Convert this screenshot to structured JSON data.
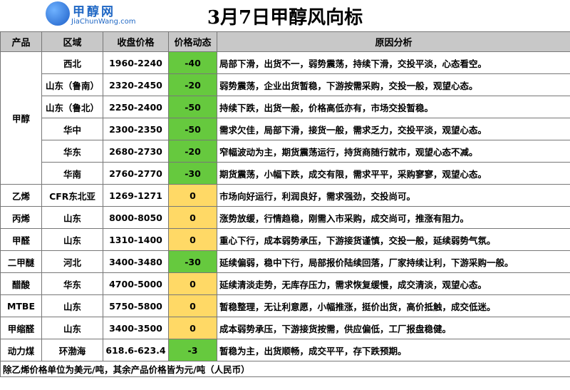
{
  "logo": {
    "cn": "甲醇网",
    "en": "JiaChunWang.com"
  },
  "title": "3月7日甲醇风向标",
  "headers": {
    "product": "产品",
    "region": "区域",
    "price": "收盘价格",
    "change": "价格动态",
    "reason": "原因分析"
  },
  "rows": [
    {
      "product": "甲醇",
      "region": "西北",
      "price": "1960-2240",
      "change": "-40",
      "reason": "局部下滑，出货不一，弱势震荡，持续下滑，交投平淡，心态看空。"
    },
    {
      "product": "",
      "region": "山东（鲁南）",
      "price": "2320-2450",
      "change": "-20",
      "reason": "弱势震荡，企业出货暂稳，下游按需采购，交投一般，观望心态。"
    },
    {
      "product": "",
      "region": "山东（鲁北）",
      "price": "2250-2400",
      "change": "-50",
      "reason": "持续下跌，出货一般，价格高低亦有，市场交投暂稳。"
    },
    {
      "product": "",
      "region": "华中",
      "price": "2300-2350",
      "change": "-50",
      "reason": "需求欠佳，局部下滑，接货一般，需求乏力，交投平淡，观望心态。"
    },
    {
      "product": "",
      "region": "华东",
      "price": "2680-2730",
      "change": "-20",
      "reason": "窄幅波动为主，期货震荡运行，持货商随行就市，观望心态不减。"
    },
    {
      "product": "",
      "region": "华南",
      "price": "2760-2770",
      "change": "-30",
      "reason": "期货震荡，小幅下跌，成交有限，需求平平，采购寥寥，观望心态。"
    },
    {
      "product": "乙烯",
      "region": "CFR东北亚",
      "price": "1269-1271",
      "change": "0",
      "reason": "市场向好运行，利润良好，需求强劲，交投尚可。"
    },
    {
      "product": "丙烯",
      "region": "山东",
      "price": "8000-8050",
      "change": "0",
      "reason": "涨势放缓，行情趋稳，刚需入市采购，成交尚可，推涨有阻力。"
    },
    {
      "product": "甲醛",
      "region": "山东",
      "price": "1310-1400",
      "change": "0",
      "reason": "重心下行，成本弱势承压，下游接货谨慎，交投一般，延续弱势气氛。"
    },
    {
      "product": "二甲醚",
      "region": "河北",
      "price": "3400-3480",
      "change": "-30",
      "reason": "延续偏弱，稳中下行，局部报价陆续回落，厂家持续让利，下游采购一般。"
    },
    {
      "product": "醋酸",
      "region": "华东",
      "price": "4700-5000",
      "change": "0",
      "reason": "延续清淡走势，无库存压力，需求恢复缓慢，成交清淡，观望心态。"
    },
    {
      "product": "MTBE",
      "region": "山东",
      "price": "5750-5800",
      "change": "0",
      "reason": "暂稳整理，无让利意愿，小幅推涨，挺价出货，高价抵触，成交低迷。"
    },
    {
      "product": "甲缩醛",
      "region": "山东",
      "price": "3400-3500",
      "change": "0",
      "reason": "成本弱势承压，下游接货按需，供应偏低，工厂报盘稳健。"
    },
    {
      "product": "动力煤",
      "region": "环渤海",
      "price": "618.6-623.4",
      "change": "-3",
      "reason": "暂稳为主，出货顺畅，成交平平，存下跌预期。"
    }
  ],
  "footer": "除乙烯价格单位为美元/吨，其余产品价格皆为元/吨（人民币）",
  "colors": {
    "negative": "#66c93e",
    "zero": "#ffd966",
    "header": "#c8c8c8"
  }
}
